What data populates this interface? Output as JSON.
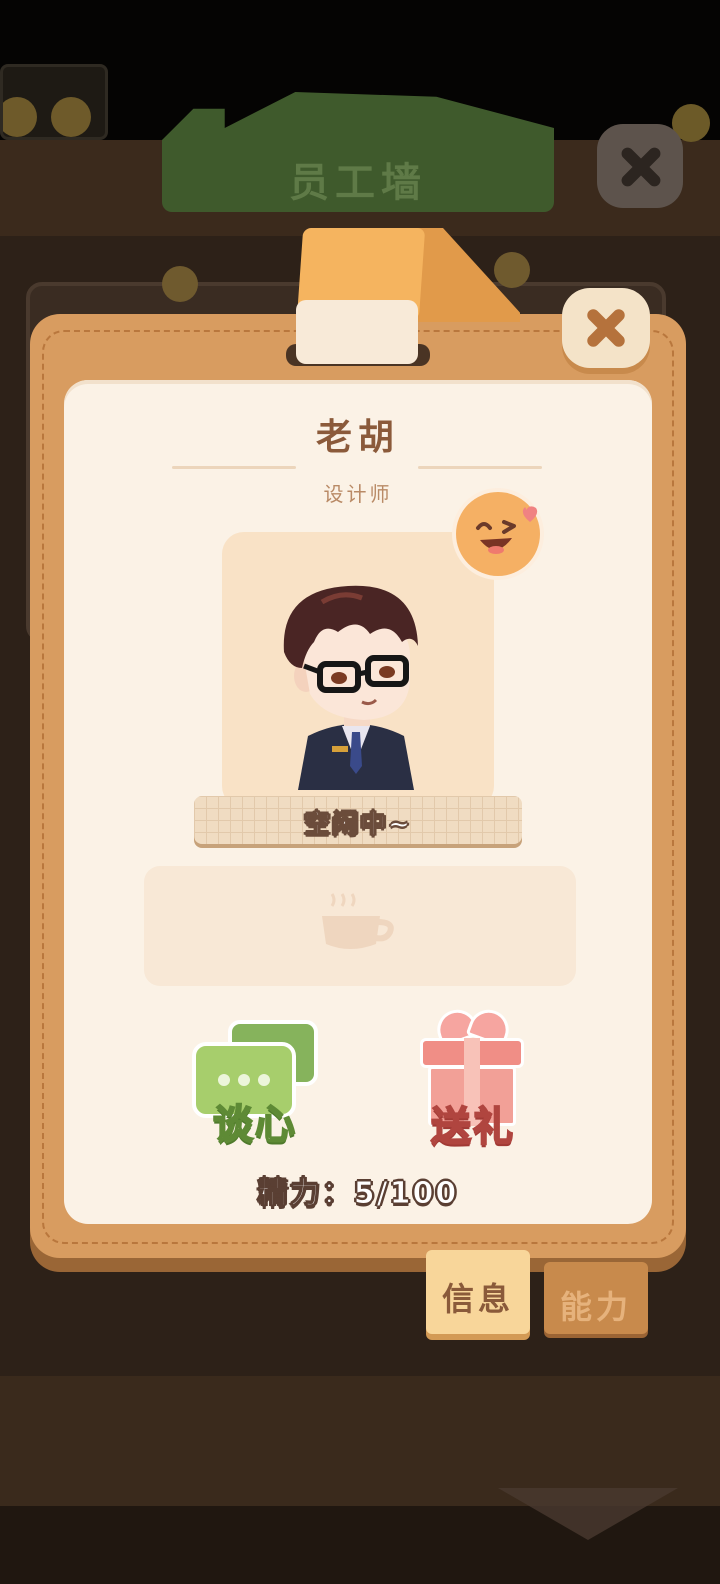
{
  "background": {
    "title": "员工墙"
  },
  "employee": {
    "name": "老胡",
    "job": "设计师",
    "mood": "happy",
    "status": "空闲中~"
  },
  "actions": {
    "chat_label": "谈心",
    "gift_label": "送礼"
  },
  "energy": {
    "label": "精力：",
    "current": 5,
    "max": 100,
    "text": "5/100"
  },
  "tabs": [
    {
      "label": "信息",
      "active": true
    },
    {
      "label": "能力",
      "active": false
    }
  ],
  "colors": {
    "card": "#d89c60",
    "panel": "#fbf2e6",
    "chat_green": "#a7ce6c",
    "gift_pink": "#f08e86",
    "tab_active": "#f8d69a"
  }
}
